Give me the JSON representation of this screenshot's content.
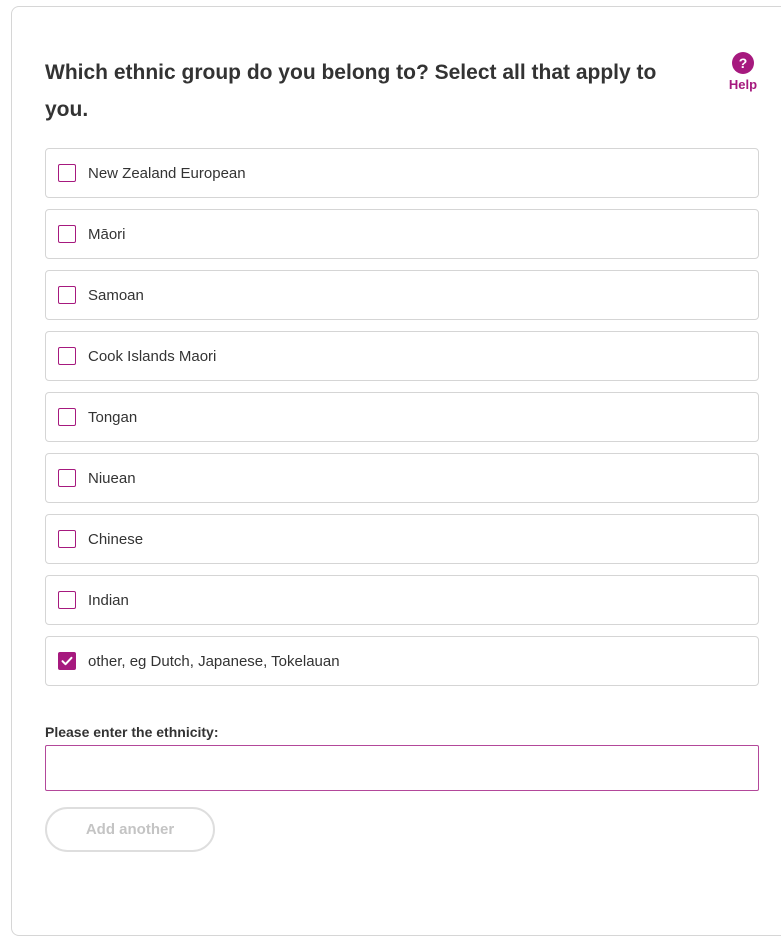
{
  "question": {
    "text": "Which ethnic group do you belong to? Select all that apply to you."
  },
  "help": {
    "icon_glyph": "?",
    "label": "Help",
    "accent_color": "#a6197e"
  },
  "options": [
    {
      "label": "New Zealand European",
      "checked": false
    },
    {
      "label": "Māori",
      "checked": false
    },
    {
      "label": "Samoan",
      "checked": false
    },
    {
      "label": "Cook Islands Maori",
      "checked": false
    },
    {
      "label": "Tongan",
      "checked": false
    },
    {
      "label": "Niuean",
      "checked": false
    },
    {
      "label": "Chinese",
      "checked": false
    },
    {
      "label": "Indian",
      "checked": false
    },
    {
      "label": "other, eg Dutch, Japanese, Tokelauan",
      "checked": true
    }
  ],
  "ethnicity_field": {
    "label": "Please enter the ethnicity:",
    "value": "",
    "placeholder": ""
  },
  "add_another": {
    "label": "Add another",
    "disabled": true
  }
}
